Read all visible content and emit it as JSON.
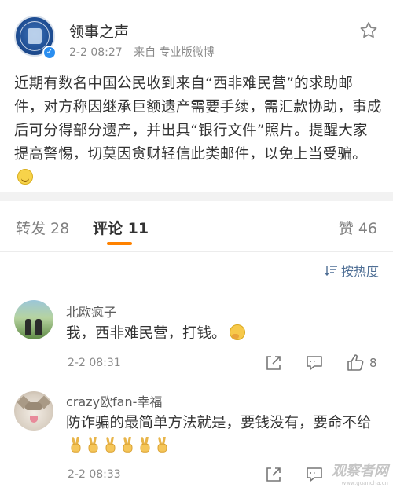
{
  "post": {
    "account_name": "领事之声",
    "timestamp": "2-2 08:27",
    "source": "来自 专业版微博",
    "body": "近期有数名中国公民收到来自“西非难民营”的求助邮件，对方称因继承巨额遗产需要手续，需汇款协助，事成后可分得部分遗产，并出具“银行文件”照片。提醒大家提高警惕，切莫因贪财轻信此类邮件，以免上当受骗。",
    "body_emoji": "smile-emoji"
  },
  "tabs": {
    "repost": "转发 28",
    "comments": "评论 11",
    "likes": "赞 46",
    "accent_color": "#ff8200"
  },
  "sort": {
    "label": "按热度",
    "icon": "sort-icon"
  },
  "comments": [
    {
      "name": "北欧疯子",
      "text": "我，西非难民营，打钱。",
      "emoji": "thinking-emoji",
      "time": "2-2 08:31",
      "likes": "8"
    },
    {
      "name": "crazy欧fan-幸福",
      "text": "防诈骗的最简单方法就是，要钱没有，要命不给",
      "emoji": "victory-hand-emoji",
      "emoji_count": 6,
      "time": "2-2 08:33"
    }
  ],
  "watermark": {
    "text": "观察者网",
    "sub": "www.guancha.cn"
  },
  "colors": {
    "link": "#4f6f95",
    "verified": "#2a8ef0"
  }
}
